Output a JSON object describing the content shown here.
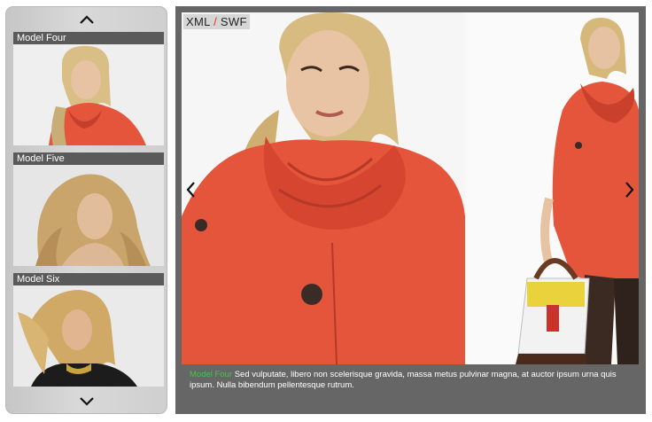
{
  "thumbnails": [
    {
      "label": "Model Four"
    },
    {
      "label": "Model Five"
    },
    {
      "label": "Model Six"
    }
  ],
  "viewer": {
    "xml_label": "XML",
    "separator": "/",
    "swf_label": "SWF",
    "caption_name": "Model Four",
    "caption_text": " Sed vulputate, libero non scelerisque gravida, massa metus pulvinar magna, at auctor ipsum urna quis ipsum. Nulla bibendum pellentesque rutrum."
  },
  "colors": {
    "accent_green": "#45c44a",
    "coat": "#e4553c",
    "frame": "#666666"
  },
  "icons": [
    "chevron-up-icon",
    "chevron-down-icon",
    "chevron-left-icon",
    "chevron-right-icon"
  ]
}
